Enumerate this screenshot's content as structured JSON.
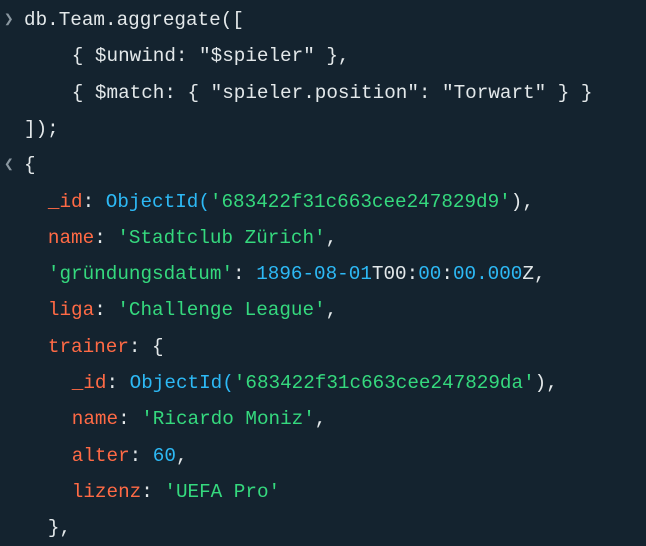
{
  "colors": {
    "background": "#14232f",
    "key": "#ff6a45",
    "string": "#35d97e",
    "number": "#2db9f5",
    "text": "#e3e8ea"
  },
  "lines": [
    {
      "marker": "input-chevron",
      "indent": 0,
      "segments": [
        {
          "text": "db.Team.aggregate([",
          "type": "txt"
        }
      ]
    },
    {
      "marker": "",
      "indent": 4,
      "segments": [
        {
          "text": "{ $unwind: \"$spieler\" },",
          "type": "txt"
        }
      ]
    },
    {
      "marker": "",
      "indent": 4,
      "segments": [
        {
          "text": "{ $match: { \"spieler.position\": \"Torwart\" } }",
          "type": "txt"
        }
      ]
    },
    {
      "marker": "",
      "indent": 0,
      "segments": [
        {
          "text": "]);",
          "type": "txt"
        }
      ]
    },
    {
      "marker": "output-chevron",
      "indent": 0,
      "segments": [
        {
          "text": "{",
          "type": "txt"
        }
      ]
    },
    {
      "marker": "",
      "indent": 2,
      "segments": [
        {
          "text": "_id",
          "type": "key"
        },
        {
          "text": ": ",
          "type": "txt"
        },
        {
          "text": "ObjectId(",
          "type": "fn"
        },
        {
          "text": "'683422f31c663cee247829d9'",
          "type": "str"
        },
        {
          "text": "),",
          "type": "txt"
        }
      ]
    },
    {
      "marker": "",
      "indent": 2,
      "segments": [
        {
          "text": "name",
          "type": "key"
        },
        {
          "text": ": ",
          "type": "txt"
        },
        {
          "text": "'Stadtclub Zürich'",
          "type": "str"
        },
        {
          "text": ",",
          "type": "txt"
        }
      ]
    },
    {
      "marker": "",
      "indent": 2,
      "segments": [
        {
          "text": "'gründungsdatum'",
          "type": "str"
        },
        {
          "text": ": ",
          "type": "txt"
        },
        {
          "text": "1896-08-01",
          "type": "num"
        },
        {
          "text": "T00:",
          "type": "txt"
        },
        {
          "text": "00",
          "type": "num"
        },
        {
          "text": ":",
          "type": "txt"
        },
        {
          "text": "00.000",
          "type": "num"
        },
        {
          "text": "Z,",
          "type": "txt"
        }
      ]
    },
    {
      "marker": "",
      "indent": 2,
      "segments": [
        {
          "text": "liga",
          "type": "key"
        },
        {
          "text": ": ",
          "type": "txt"
        },
        {
          "text": "'Challenge League'",
          "type": "str"
        },
        {
          "text": ",",
          "type": "txt"
        }
      ]
    },
    {
      "marker": "",
      "indent": 2,
      "segments": [
        {
          "text": "trainer",
          "type": "key"
        },
        {
          "text": ": {",
          "type": "txt"
        }
      ]
    },
    {
      "marker": "",
      "indent": 4,
      "segments": [
        {
          "text": "_id",
          "type": "key"
        },
        {
          "text": ": ",
          "type": "txt"
        },
        {
          "text": "ObjectId(",
          "type": "fn"
        },
        {
          "text": "'683422f31c663cee247829da'",
          "type": "str"
        },
        {
          "text": "),",
          "type": "txt"
        }
      ]
    },
    {
      "marker": "",
      "indent": 4,
      "segments": [
        {
          "text": "name",
          "type": "key"
        },
        {
          "text": ": ",
          "type": "txt"
        },
        {
          "text": "'Ricardo Moniz'",
          "type": "str"
        },
        {
          "text": ",",
          "type": "txt"
        }
      ]
    },
    {
      "marker": "",
      "indent": 4,
      "segments": [
        {
          "text": "alter",
          "type": "key"
        },
        {
          "text": ": ",
          "type": "txt"
        },
        {
          "text": "60",
          "type": "num"
        },
        {
          "text": ",",
          "type": "txt"
        }
      ]
    },
    {
      "marker": "",
      "indent": 4,
      "segments": [
        {
          "text": "lizenz",
          "type": "key"
        },
        {
          "text": ": ",
          "type": "txt"
        },
        {
          "text": "'UEFA Pro'",
          "type": "str"
        }
      ]
    },
    {
      "marker": "",
      "indent": 2,
      "segments": [
        {
          "text": "},",
          "type": "txt"
        }
      ]
    }
  ]
}
